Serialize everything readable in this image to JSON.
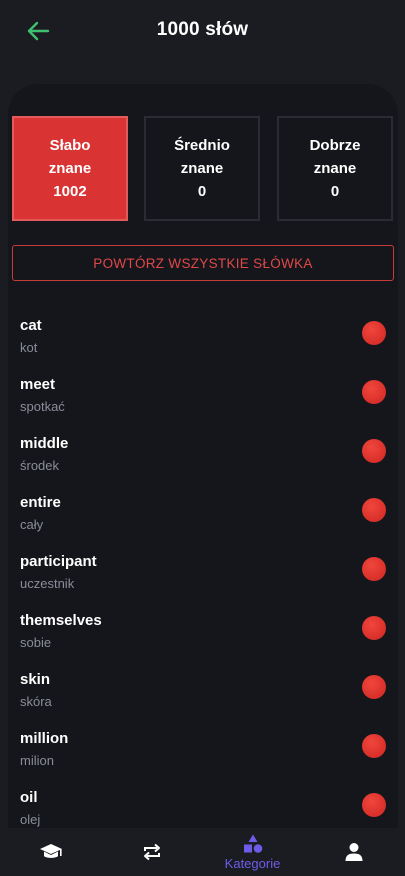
{
  "header": {
    "title": "1000 słów",
    "back_icon": "arrow-left-icon",
    "back_color": "#3fbf6f"
  },
  "stats": [
    {
      "line1": "Słabo",
      "line2": "znane",
      "count": "1002",
      "active": true,
      "color": "#d93333"
    },
    {
      "line1": "Średnio",
      "line2": "znane",
      "count": "0",
      "active": false
    },
    {
      "line1": "Dobrze",
      "line2": "znane",
      "count": "0",
      "active": false
    }
  ],
  "repeat_button": {
    "label": "POWTÓRZ WSZYSTKIE SŁÓWKA",
    "color": "#e04848"
  },
  "words": [
    {
      "en": "cat",
      "pl": "kot"
    },
    {
      "en": "meet",
      "pl": "spotkać"
    },
    {
      "en": "middle",
      "pl": "środek"
    },
    {
      "en": "entire",
      "pl": "cały"
    },
    {
      "en": "participant",
      "pl": "uczestnik"
    },
    {
      "en": "themselves",
      "pl": "sobie"
    },
    {
      "en": "skin",
      "pl": "skóra"
    },
    {
      "en": "million",
      "pl": "milion"
    },
    {
      "en": "oil",
      "pl": "olej"
    }
  ],
  "tabbar": {
    "tabs": [
      {
        "icon": "graduation-cap-icon",
        "label": ""
      },
      {
        "icon": "repeat-icon",
        "label": ""
      },
      {
        "icon": "shapes-icon",
        "label": "Kategorie",
        "active": true
      },
      {
        "icon": "user-icon",
        "label": ""
      }
    ],
    "active_color": "#6d5ce8"
  }
}
